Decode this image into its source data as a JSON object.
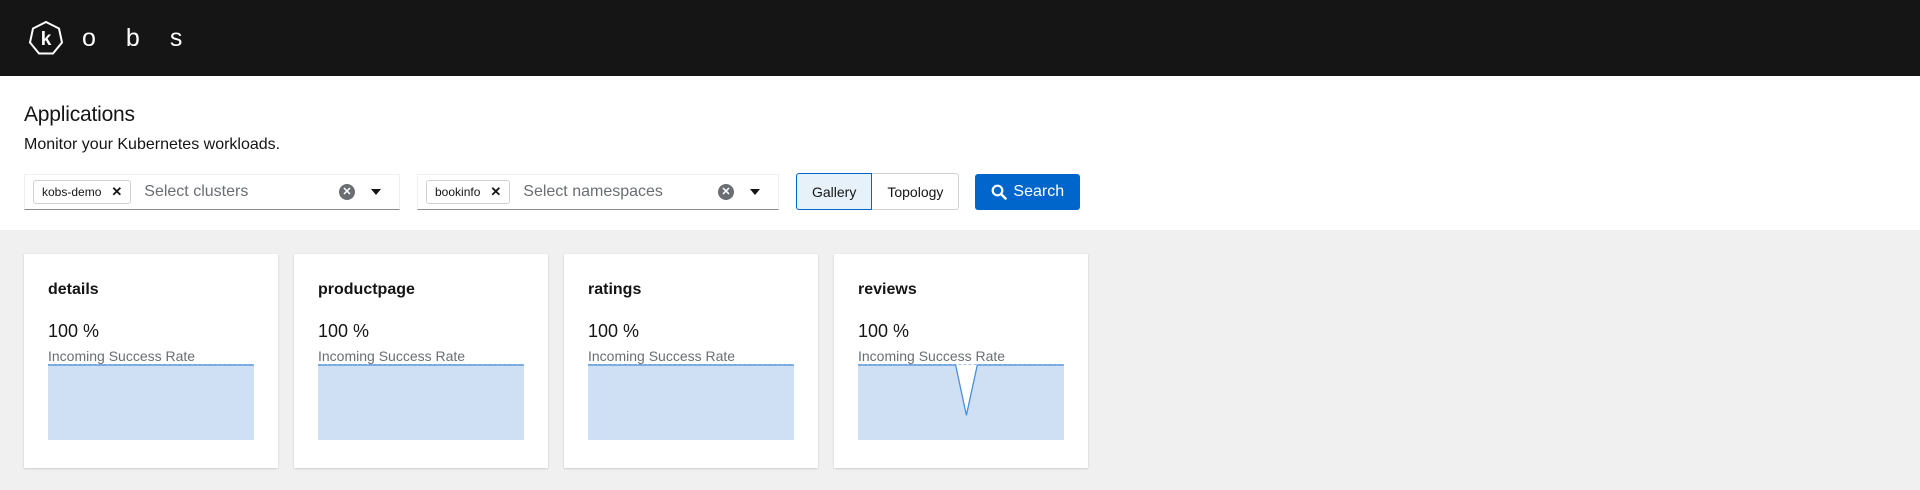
{
  "brand": {
    "name_letters": [
      "o",
      "b",
      "s"
    ],
    "logo_letter": "k",
    "logo_icon": "kobs-heptagon-k-icon"
  },
  "header": {
    "title": "Applications",
    "subtitle": "Monitor your Kubernetes workloads."
  },
  "filters": {
    "clusters": {
      "chips": [
        "kobs-demo"
      ],
      "placeholder": "Select clusters"
    },
    "namespaces": {
      "chips": [
        "bookinfo"
      ],
      "placeholder": "Select namespaces"
    }
  },
  "view_toggle": {
    "options": [
      "Gallery",
      "Topology"
    ],
    "selected": "Gallery"
  },
  "search": {
    "label": "Search",
    "icon": "search-icon"
  },
  "colors": {
    "accent": "#0066cc",
    "sparkline_fill": "#cfe0f5",
    "sparkline_line": "#4a90d9",
    "masthead": "#151515"
  },
  "applications": [
    {
      "name": "details",
      "value": "100 %",
      "label": "Incoming Success Rate",
      "series": [
        100,
        100,
        100,
        100,
        100,
        100,
        100,
        100,
        100,
        100,
        100,
        100,
        100,
        100,
        100,
        100,
        100,
        100,
        100,
        100
      ]
    },
    {
      "name": "productpage",
      "value": "100 %",
      "label": "Incoming Success Rate",
      "series": [
        100,
        100,
        100,
        100,
        100,
        100,
        100,
        100,
        100,
        100,
        100,
        100,
        100,
        100,
        100,
        100,
        100,
        100,
        100,
        100
      ]
    },
    {
      "name": "ratings",
      "value": "100 %",
      "label": "Incoming Success Rate",
      "series": [
        100,
        100,
        100,
        100,
        100,
        100,
        100,
        100,
        100,
        100,
        100,
        100,
        100,
        100,
        100,
        100,
        100,
        100,
        100,
        100
      ]
    },
    {
      "name": "reviews",
      "value": "100 %",
      "label": "Incoming Success Rate",
      "series": [
        100,
        100,
        100,
        100,
        100,
        100,
        100,
        100,
        100,
        100,
        34,
        100,
        100,
        100,
        100,
        100,
        100,
        100,
        100,
        100
      ]
    }
  ]
}
